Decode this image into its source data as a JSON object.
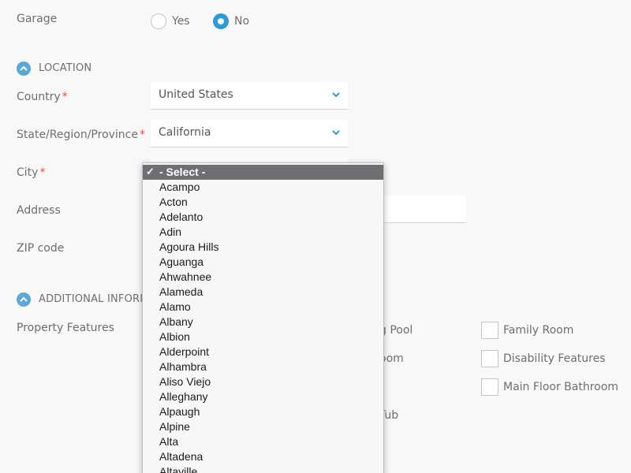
{
  "garage": {
    "label": "Garage",
    "options": [
      {
        "label": "Yes",
        "checked": false
      },
      {
        "label": "No",
        "checked": true
      }
    ]
  },
  "location": {
    "section_title": "LOCATION",
    "country": {
      "label": "Country",
      "required": "*",
      "value": "United States"
    },
    "state": {
      "label": "State/Region/Province",
      "required": "*",
      "value": "California"
    },
    "city": {
      "label": "City",
      "required": "*"
    },
    "address": {
      "label": "Address"
    },
    "zip": {
      "label": "ZIP code"
    }
  },
  "additional": {
    "section_title": "ADDITIONAL INFORMA",
    "property_features": {
      "label": "Property Features",
      "left_partial": [
        "g Pool",
        "oom",
        "Tub"
      ],
      "right": [
        "Family Room",
        "Disability Features",
        "Main Floor Bathroom"
      ]
    }
  },
  "city_dropdown": {
    "selected_label": "- Select -",
    "check_glyph": "✓",
    "items": [
      "Acampo",
      "Acton",
      "Adelanto",
      "Adin",
      "Agoura Hills",
      "Aguanga",
      "Ahwahnee",
      "Alameda",
      "Alamo",
      "Albany",
      "Albion",
      "Alderpoint",
      "Alhambra",
      "Aliso Viejo",
      "Alleghany",
      "Alpaugh",
      "Alpine",
      "Alta",
      "Altadena",
      "Altaville"
    ]
  },
  "colors": {
    "accent": "#2e9ad6",
    "section_icon": "#5aa8d8",
    "required": "#d9534f",
    "dropdown_selected_bg": "#6e6e73"
  },
  "icons": {
    "section_toggle": "chevron-up-icon",
    "select_arrow": "chevron-down-icon",
    "selected_mark": "checkmark-icon"
  }
}
